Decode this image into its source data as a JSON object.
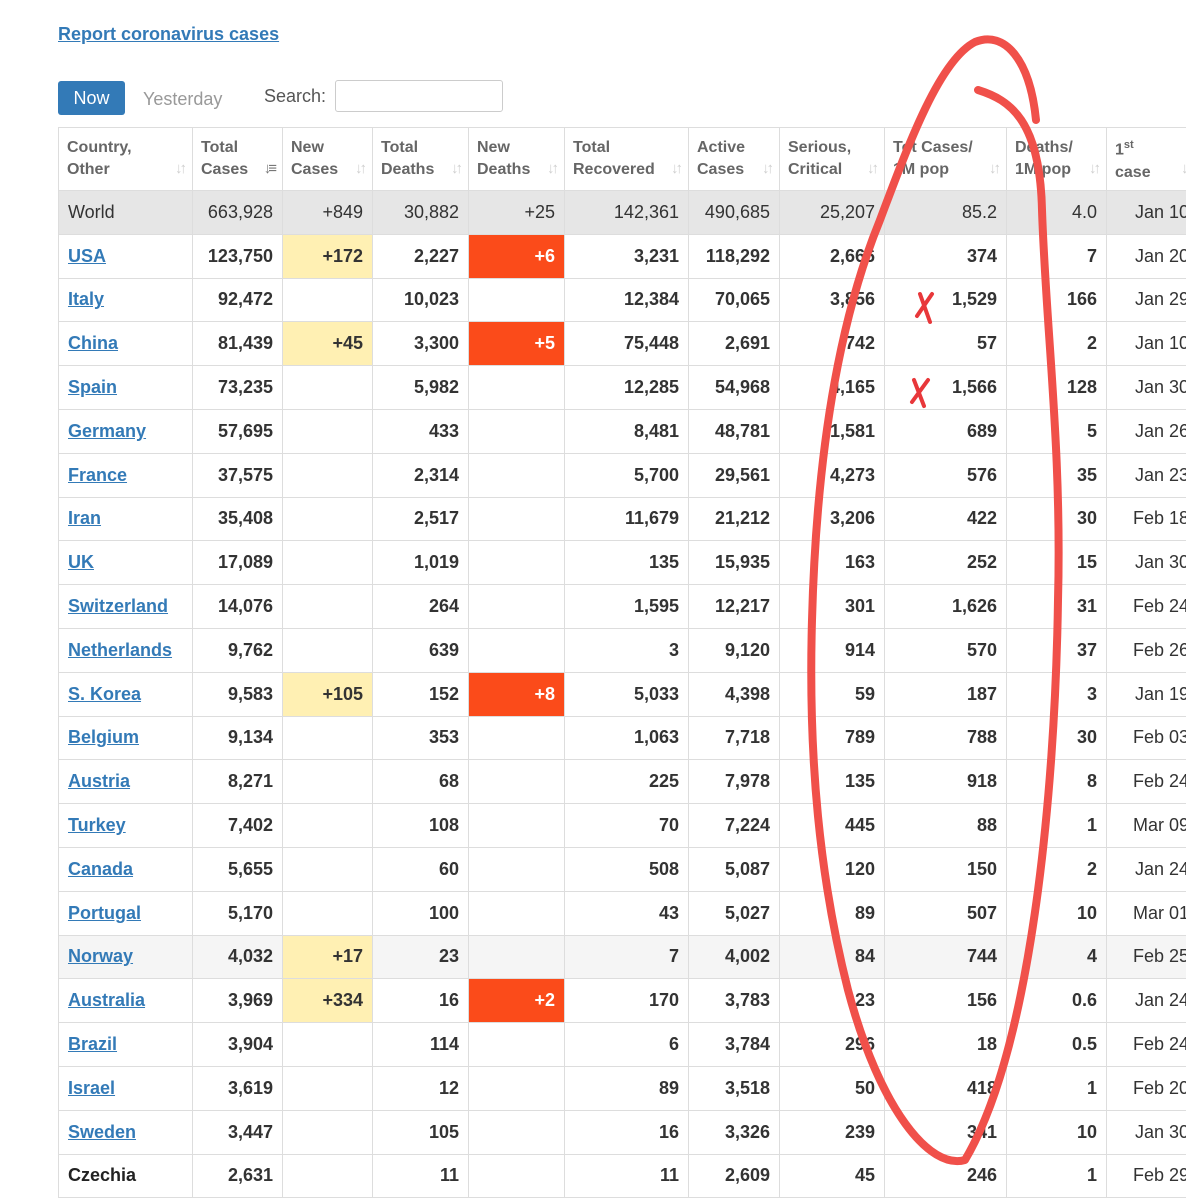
{
  "header": {
    "report_link": "Report coronavirus cases"
  },
  "tabs": {
    "now": "Now",
    "yesterday": "Yesterday"
  },
  "search": {
    "label": "Search:",
    "value": "",
    "placeholder": ""
  },
  "columns": [
    {
      "line1": "Country,",
      "line2": "Other",
      "sort": "both"
    },
    {
      "line1": "Total",
      "line2": "Cases",
      "sort": "desc"
    },
    {
      "line1": "New",
      "line2": "Cases",
      "sort": "both"
    },
    {
      "line1": "Total",
      "line2": "Deaths",
      "sort": "both"
    },
    {
      "line1": "New",
      "line2": "Deaths",
      "sort": "both"
    },
    {
      "line1": "Total",
      "line2": "Recovered",
      "sort": "both"
    },
    {
      "line1": "Active",
      "line2": "Cases",
      "sort": "both"
    },
    {
      "line1": "Serious,",
      "line2": "Critical",
      "sort": "both"
    },
    {
      "line1": "Tot Cases/",
      "line2": "1M pop",
      "sort": "both"
    },
    {
      "line1": "Deaths/",
      "line2": "1M pop",
      "sort": "both"
    },
    {
      "line1": "1",
      "line1_sup": "st",
      "line2": "case",
      "sort": "both"
    }
  ],
  "rows": [
    {
      "country": "World",
      "link": false,
      "total_cases": "663,928",
      "new_cases": "+849",
      "total_deaths": "30,882",
      "new_deaths": "+25",
      "total_recovered": "142,361",
      "active_cases": "490,685",
      "serious_critical": "25,207",
      "tot_cases_1m": "85.2",
      "deaths_1m": "4.0",
      "first_case": "Jan 10"
    },
    {
      "country": "USA",
      "link": true,
      "total_cases": "123,750",
      "new_cases": "+172",
      "total_deaths": "2,227",
      "new_deaths": "+6",
      "total_recovered": "3,231",
      "active_cases": "118,292",
      "serious_critical": "2,666",
      "tot_cases_1m": "374",
      "deaths_1m": "7",
      "first_case": "Jan 20"
    },
    {
      "country": "Italy",
      "link": true,
      "total_cases": "92,472",
      "new_cases": "",
      "total_deaths": "10,023",
      "new_deaths": "",
      "total_recovered": "12,384",
      "active_cases": "70,065",
      "serious_critical": "3,856",
      "tot_cases_1m": "1,529",
      "deaths_1m": "166",
      "first_case": "Jan 29"
    },
    {
      "country": "China",
      "link": true,
      "total_cases": "81,439",
      "new_cases": "+45",
      "total_deaths": "3,300",
      "new_deaths": "+5",
      "total_recovered": "75,448",
      "active_cases": "2,691",
      "serious_critical": "742",
      "tot_cases_1m": "57",
      "deaths_1m": "2",
      "first_case": "Jan 10"
    },
    {
      "country": "Spain",
      "link": true,
      "total_cases": "73,235",
      "new_cases": "",
      "total_deaths": "5,982",
      "new_deaths": "",
      "total_recovered": "12,285",
      "active_cases": "54,968",
      "serious_critical": "4,165",
      "tot_cases_1m": "1,566",
      "deaths_1m": "128",
      "first_case": "Jan 30"
    },
    {
      "country": "Germany",
      "link": true,
      "total_cases": "57,695",
      "new_cases": "",
      "total_deaths": "433",
      "new_deaths": "",
      "total_recovered": "8,481",
      "active_cases": "48,781",
      "serious_critical": "1,581",
      "tot_cases_1m": "689",
      "deaths_1m": "5",
      "first_case": "Jan 26"
    },
    {
      "country": "France",
      "link": true,
      "total_cases": "37,575",
      "new_cases": "",
      "total_deaths": "2,314",
      "new_deaths": "",
      "total_recovered": "5,700",
      "active_cases": "29,561",
      "serious_critical": "4,273",
      "tot_cases_1m": "576",
      "deaths_1m": "35",
      "first_case": "Jan 23"
    },
    {
      "country": "Iran",
      "link": true,
      "total_cases": "35,408",
      "new_cases": "",
      "total_deaths": "2,517",
      "new_deaths": "",
      "total_recovered": "11,679",
      "active_cases": "21,212",
      "serious_critical": "3,206",
      "tot_cases_1m": "422",
      "deaths_1m": "30",
      "first_case": "Feb 18"
    },
    {
      "country": "UK",
      "link": true,
      "total_cases": "17,089",
      "new_cases": "",
      "total_deaths": "1,019",
      "new_deaths": "",
      "total_recovered": "135",
      "active_cases": "15,935",
      "serious_critical": "163",
      "tot_cases_1m": "252",
      "deaths_1m": "15",
      "first_case": "Jan 30"
    },
    {
      "country": "Switzerland",
      "link": true,
      "total_cases": "14,076",
      "new_cases": "",
      "total_deaths": "264",
      "new_deaths": "",
      "total_recovered": "1,595",
      "active_cases": "12,217",
      "serious_critical": "301",
      "tot_cases_1m": "1,626",
      "deaths_1m": "31",
      "first_case": "Feb 24"
    },
    {
      "country": "Netherlands",
      "link": true,
      "total_cases": "9,762",
      "new_cases": "",
      "total_deaths": "639",
      "new_deaths": "",
      "total_recovered": "3",
      "active_cases": "9,120",
      "serious_critical": "914",
      "tot_cases_1m": "570",
      "deaths_1m": "37",
      "first_case": "Feb 26"
    },
    {
      "country": "S. Korea",
      "link": true,
      "total_cases": "9,583",
      "new_cases": "+105",
      "total_deaths": "152",
      "new_deaths": "+8",
      "total_recovered": "5,033",
      "active_cases": "4,398",
      "serious_critical": "59",
      "tot_cases_1m": "187",
      "deaths_1m": "3",
      "first_case": "Jan 19"
    },
    {
      "country": "Belgium",
      "link": true,
      "total_cases": "9,134",
      "new_cases": "",
      "total_deaths": "353",
      "new_deaths": "",
      "total_recovered": "1,063",
      "active_cases": "7,718",
      "serious_critical": "789",
      "tot_cases_1m": "788",
      "deaths_1m": "30",
      "first_case": "Feb 03"
    },
    {
      "country": "Austria",
      "link": true,
      "total_cases": "8,271",
      "new_cases": "",
      "total_deaths": "68",
      "new_deaths": "",
      "total_recovered": "225",
      "active_cases": "7,978",
      "serious_critical": "135",
      "tot_cases_1m": "918",
      "deaths_1m": "8",
      "first_case": "Feb 24"
    },
    {
      "country": "Turkey",
      "link": true,
      "total_cases": "7,402",
      "new_cases": "",
      "total_deaths": "108",
      "new_deaths": "",
      "total_recovered": "70",
      "active_cases": "7,224",
      "serious_critical": "445",
      "tot_cases_1m": "88",
      "deaths_1m": "1",
      "first_case": "Mar 09"
    },
    {
      "country": "Canada",
      "link": true,
      "total_cases": "5,655",
      "new_cases": "",
      "total_deaths": "60",
      "new_deaths": "",
      "total_recovered": "508",
      "active_cases": "5,087",
      "serious_critical": "120",
      "tot_cases_1m": "150",
      "deaths_1m": "2",
      "first_case": "Jan 24"
    },
    {
      "country": "Portugal",
      "link": true,
      "total_cases": "5,170",
      "new_cases": "",
      "total_deaths": "100",
      "new_deaths": "",
      "total_recovered": "43",
      "active_cases": "5,027",
      "serious_critical": "89",
      "tot_cases_1m": "507",
      "deaths_1m": "10",
      "first_case": "Mar 01"
    },
    {
      "country": "Norway",
      "link": true,
      "total_cases": "4,032",
      "new_cases": "+17",
      "total_deaths": "23",
      "new_deaths": "",
      "total_recovered": "7",
      "active_cases": "4,002",
      "serious_critical": "84",
      "tot_cases_1m": "744",
      "deaths_1m": "4",
      "first_case": "Feb 25"
    },
    {
      "country": "Australia",
      "link": true,
      "total_cases": "3,969",
      "new_cases": "+334",
      "total_deaths": "16",
      "new_deaths": "+2",
      "total_recovered": "170",
      "active_cases": "3,783",
      "serious_critical": "23",
      "tot_cases_1m": "156",
      "deaths_1m": "0.6",
      "first_case": "Jan 24"
    },
    {
      "country": "Brazil",
      "link": true,
      "total_cases": "3,904",
      "new_cases": "",
      "total_deaths": "114",
      "new_deaths": "",
      "total_recovered": "6",
      "active_cases": "3,784",
      "serious_critical": "296",
      "tot_cases_1m": "18",
      "deaths_1m": "0.5",
      "first_case": "Feb 24"
    },
    {
      "country": "Israel",
      "link": true,
      "total_cases": "3,619",
      "new_cases": "",
      "total_deaths": "12",
      "new_deaths": "",
      "total_recovered": "89",
      "active_cases": "3,518",
      "serious_critical": "50",
      "tot_cases_1m": "418",
      "deaths_1m": "1",
      "first_case": "Feb 20"
    },
    {
      "country": "Sweden",
      "link": true,
      "total_cases": "3,447",
      "new_cases": "",
      "total_deaths": "105",
      "new_deaths": "",
      "total_recovered": "16",
      "active_cases": "3,326",
      "serious_critical": "239",
      "tot_cases_1m": "341",
      "deaths_1m": "10",
      "first_case": "Jan 30"
    },
    {
      "country": "Czechia",
      "link": false,
      "total_cases": "2,631",
      "new_cases": "",
      "total_deaths": "11",
      "new_deaths": "",
      "total_recovered": "11",
      "active_cases": "2,609",
      "serious_critical": "45",
      "tot_cases_1m": "246",
      "deaths_1m": "1",
      "first_case": "Feb 29"
    }
  ],
  "colors": {
    "link": "#337ab7",
    "new_cases_highlight": "#fff0b3",
    "new_deaths_highlight": "#fb4b1a",
    "world_row": "#e6e6e6",
    "annotation_ink": "#f0504a"
  },
  "annotations": {
    "circled_column": "Tot Cases/ 1M pop",
    "x_marks_on_rows": [
      "Italy",
      "Spain"
    ]
  }
}
